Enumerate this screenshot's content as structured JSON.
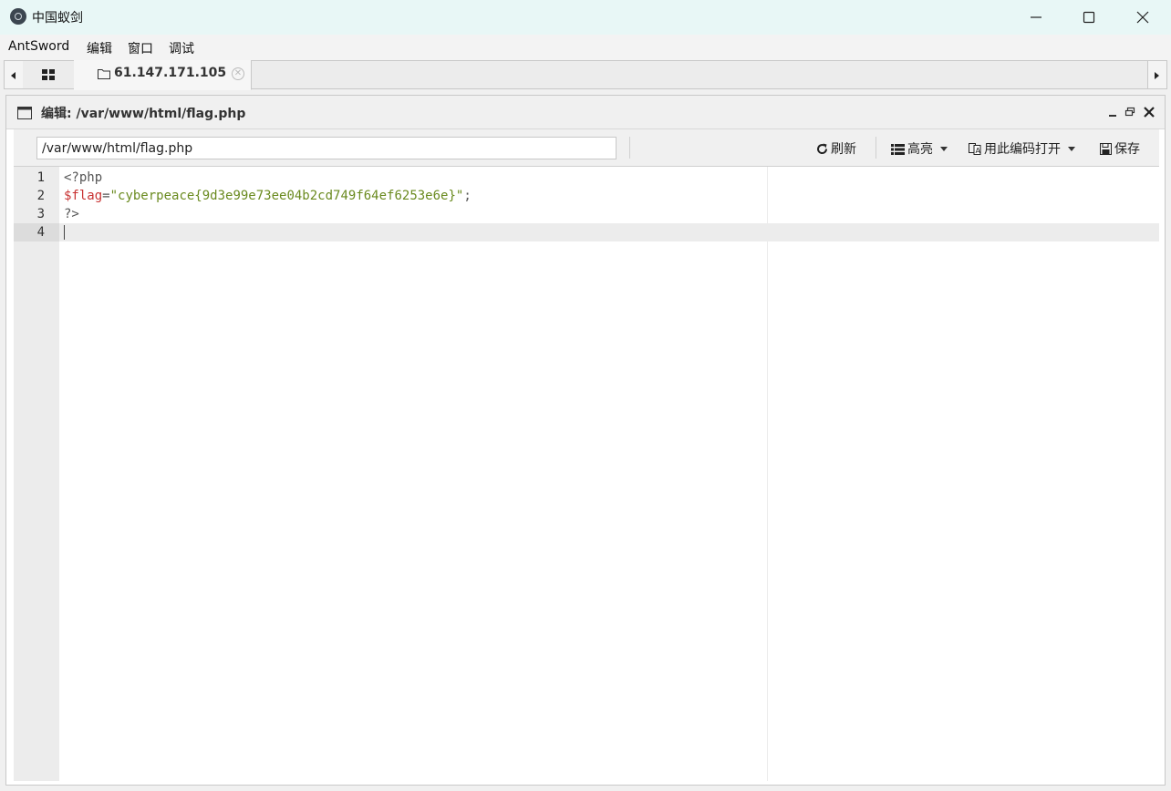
{
  "window": {
    "title": "中国蚁剑",
    "icons": {
      "app": "antsword-logo-icon",
      "minimize": "minimize-icon",
      "maximize": "maximize-icon",
      "close": "close-icon"
    }
  },
  "menu": [
    "AntSword",
    "编辑",
    "窗口",
    "调试"
  ],
  "tabs": {
    "home_icon": "grid-icon",
    "active": {
      "label": "61.147.171.105",
      "icon": "folder-icon",
      "close_icon": "tab-close-icon"
    }
  },
  "panel": {
    "title": "编辑: /var/www/html/flag.php",
    "icon": "window-icon",
    "controls": [
      "minimize-icon",
      "restore-icon",
      "close-icon"
    ]
  },
  "toolbar": {
    "path_value": "/var/www/html/flag.php",
    "refresh_label": "刷新",
    "highlight_label": "高亮",
    "encoding_label": "用此编码打开",
    "save_label": "保存"
  },
  "editor": {
    "line_numbers": [
      "1",
      "2",
      "3",
      "4"
    ],
    "lines": [
      {
        "segments": [
          {
            "text": "<?php",
            "type": "plain"
          }
        ]
      },
      {
        "segments": [
          {
            "text": "$flag",
            "type": "var"
          },
          {
            "text": "=",
            "type": "op"
          },
          {
            "text": "\"cyberpeace{9d3e99e73ee04b2cd749f64ef6253e6e}\"",
            "type": "str"
          },
          {
            "text": ";",
            "type": "plain"
          }
        ]
      },
      {
        "segments": [
          {
            "text": "?>",
            "type": "plain"
          }
        ]
      },
      {
        "segments": []
      }
    ],
    "active_line": 4
  },
  "colors": {
    "titlebar": "#e8f7f6",
    "string": "#6a8a1f",
    "variable": "#c83232"
  }
}
